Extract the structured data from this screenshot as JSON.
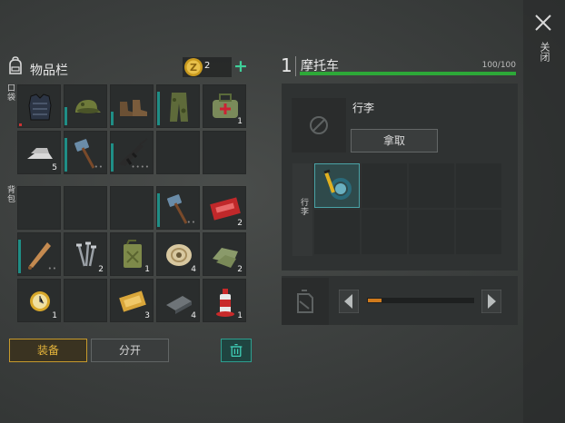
{
  "close": {
    "label": "关闭",
    "icon": "close-icon"
  },
  "inventory": {
    "title": "物品栏",
    "coins": "2",
    "plus": "+",
    "pockets_label": "口袋",
    "backpack_label": "背包",
    "pocket_slots": [
      {
        "icon": "armor-vest-icon",
        "count": "",
        "durability": 0.0,
        "red": true
      },
      {
        "icon": "camo-cap-icon",
        "count": "",
        "durability": 0.45
      },
      {
        "icon": "boots-icon",
        "count": "",
        "durability": 0.35
      },
      {
        "icon": "camo-pants-icon",
        "count": "",
        "durability": 0.85
      },
      {
        "icon": "medkit-bag-icon",
        "count": "1",
        "durability": 0
      },
      {
        "icon": "metal-ingot-icon",
        "count": "5",
        "durability": 0
      },
      {
        "icon": "sledgehammer-icon",
        "count": "",
        "durability": 0.85,
        "dots": "••"
      },
      {
        "icon": "assault-rifle-icon",
        "count": "",
        "durability": 0.7,
        "dots": "••••"
      },
      {
        "icon": "",
        "count": ""
      },
      {
        "icon": "",
        "count": ""
      }
    ],
    "backpack_slots": [
      {
        "icon": "",
        "count": ""
      },
      {
        "icon": "",
        "count": ""
      },
      {
        "icon": "",
        "count": ""
      },
      {
        "icon": "sledgehammer-icon",
        "count": "",
        "durability": 0.85,
        "dots": "••"
      },
      {
        "icon": "red-coupon-icon",
        "count": "2"
      },
      {
        "icon": "baseball-bat-icon",
        "count": "",
        "durability": 0.85,
        "dots": "••"
      },
      {
        "icon": "nails-icon",
        "count": "2"
      },
      {
        "icon": "jerrycan-icon",
        "count": "1"
      },
      {
        "icon": "rope-spool-icon",
        "count": "4"
      },
      {
        "icon": "cloth-scraps-icon",
        "count": "2"
      },
      {
        "icon": "gold-watch-icon",
        "count": "1"
      },
      {
        "icon": "",
        "count": ""
      },
      {
        "icon": "gold-ticket-icon",
        "count": "3"
      },
      {
        "icon": "metal-plate-icon",
        "count": "4"
      },
      {
        "icon": "spray-can-icon",
        "count": "1"
      }
    ],
    "equip_label": "装备",
    "split_label": "分开",
    "trash_icon": "trash-icon"
  },
  "vehicle": {
    "number": "1",
    "title": "摩托车",
    "hp": "100/100",
    "hp_fraction": 1.0,
    "luggage_label": "行李",
    "take_label": "拿取",
    "luggage_side_label": "行李",
    "luggage_items": [
      {
        "icon": "snorkel-mask-icon",
        "selected": true
      },
      {
        "icon": ""
      },
      {
        "icon": ""
      },
      {
        "icon": ""
      },
      {
        "icon": ""
      },
      {
        "icon": ""
      },
      {
        "icon": ""
      },
      {
        "icon": ""
      }
    ],
    "fuel_fraction": 0.13
  },
  "colors": {
    "accent_gold": "#e7b63b",
    "accent_teal": "#2d9f8f",
    "hp_green": "#2da838",
    "fuel_orange": "#d07a1c"
  }
}
